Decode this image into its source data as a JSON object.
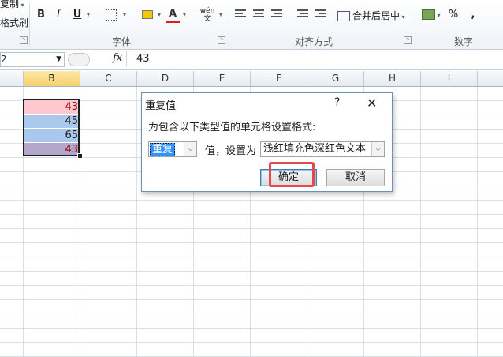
{
  "ribbon": {
    "clipboard_copy": "复制",
    "clipboard_painter": "格式刷",
    "font_group_label": "字体",
    "align_group_label": "对齐方式",
    "number_group_label": "数字",
    "bold": "B",
    "italic": "I",
    "underline": "U",
    "font_color_glyph": "A",
    "phonetic_glyph": "wén 文",
    "merge_center": "合并后居中",
    "percent": "%",
    "comma": ","
  },
  "formula_bar": {
    "name_box": "2",
    "fx_label": "fx",
    "value": "43"
  },
  "sheet": {
    "columns": [
      "B",
      "C",
      "D",
      "E",
      "F",
      "G",
      "H",
      "I"
    ],
    "selected_column": "B",
    "cells": [
      {
        "value": "43",
        "fill": "#FFC7CE",
        "font": "#9C0006"
      },
      {
        "value": "45",
        "fill": "#A9C8EE",
        "font": "#1F1F1F"
      },
      {
        "value": "65",
        "fill": "#A9C8EE",
        "font": "#1F1F1F"
      },
      {
        "value": "43",
        "fill": "#B2A6C9",
        "font": "#9C0006"
      }
    ]
  },
  "dialog": {
    "title": "重复值",
    "help": "?",
    "close": "✕",
    "prompt": "为包含以下类型值的单元格设置格式:",
    "type_value": "重复",
    "middle_text": "值，设置为",
    "format_value": "浅红填充色深红色文本",
    "ok": "确定",
    "cancel": "取消"
  },
  "colors": {
    "highlight": "#E8484C",
    "selected_header": "#F6CF6A"
  }
}
